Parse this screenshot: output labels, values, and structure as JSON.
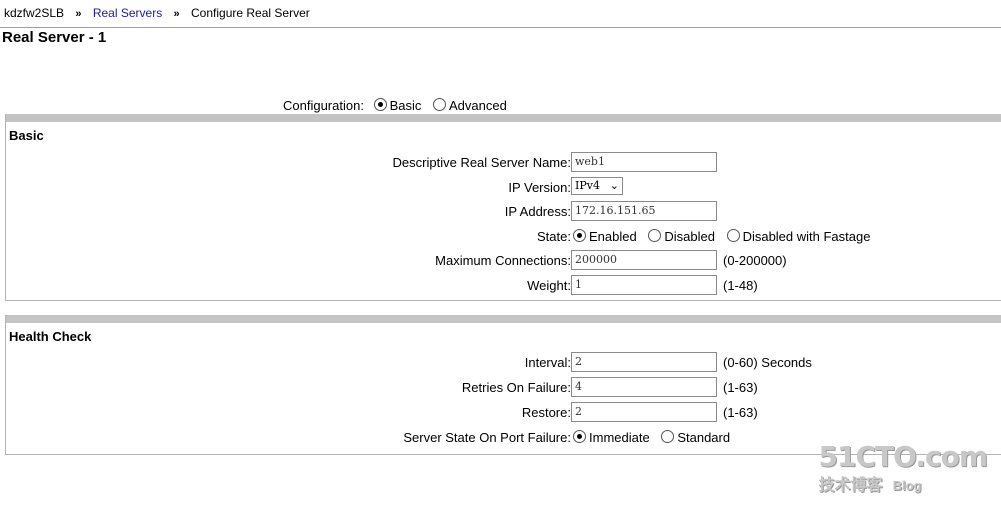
{
  "breadcrumb": {
    "host": "kdzfw2SLB",
    "section": "Real Servers",
    "current": "Configure Real Server",
    "separator": "»"
  },
  "page_title": "Real Server - 1",
  "configuration": {
    "label": "Configuration",
    "options": [
      "Basic",
      "Advanced"
    ],
    "selected": "Basic"
  },
  "basic": {
    "title": "Basic",
    "name_label": "Descriptive Real Server Name",
    "name_value": "web1",
    "ip_version_label": "IP Version",
    "ip_version_value": "IPv4",
    "ip_address_label": "IP Address",
    "ip_address_value": "172.16.151.65",
    "state_label": "State",
    "state_options": [
      "Enabled",
      "Disabled",
      "Disabled with Fastage"
    ],
    "state_selected": "Enabled",
    "max_conn_label": "Maximum Connections",
    "max_conn_value": "200000",
    "max_conn_hint": "(0-200000)",
    "weight_label": "Weight",
    "weight_value": "1",
    "weight_hint": "(1-48)"
  },
  "health": {
    "title": "Health Check",
    "interval_label": "Interval",
    "interval_value": "2",
    "interval_hint": "(0-60) Seconds",
    "retries_label": "Retries On Failure",
    "retries_value": "4",
    "retries_hint": "(1-63)",
    "restore_label": "Restore",
    "restore_value": "2",
    "restore_hint": "(1-63)",
    "port_failure_label": "Server State On Port Failure",
    "port_failure_options": [
      "Immediate",
      "Standard"
    ],
    "port_failure_selected": "Immediate"
  },
  "watermark": {
    "main": "51CTO.com",
    "sub": "技术博客",
    "blog": "Blog"
  }
}
